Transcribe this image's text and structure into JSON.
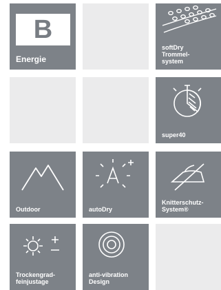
{
  "tiles": {
    "energie": {
      "letter": "B",
      "label": "Energie"
    },
    "softdry": {
      "label": "softDry\nTrommel-\nsystem"
    },
    "super40": {
      "label": "super40"
    },
    "outdoor": {
      "label": "Outdoor"
    },
    "autodry": {
      "label": "autoDry"
    },
    "knitterschutz": {
      "label": "Knitterschutz-\nSystem®"
    },
    "trockengrad": {
      "label": "Trockengrad-\nfeinjustage"
    },
    "antivibration": {
      "label": "anti-vibration\nDesign"
    }
  },
  "colors": {
    "tile": "#7d8288",
    "empty": "#ebebec",
    "text": "#ffffff"
  }
}
